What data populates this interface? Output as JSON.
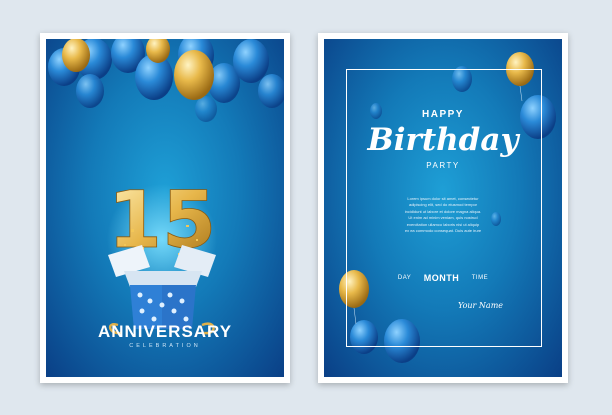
{
  "colors": {
    "page_background": "#dfe7ee",
    "card_border": "#ffffff",
    "card_blue_light": "#1e9fd6",
    "card_blue_dark": "#0a3f86",
    "balloon_gold": "#e8b94a",
    "balloon_blue": "#2a8ad8",
    "text_white": "#ffffff"
  },
  "left_card": {
    "number": "15",
    "title": "ANNIVERSARY",
    "subtitle": "CELEBRATION"
  },
  "right_card": {
    "happy": "HAPPY",
    "birthday": "Birthday",
    "party": "PARTY",
    "body_lines": [
      "Lorem ipsum dolor sit amet, consectetur",
      "adipiscing elit, sed do eiusmod tempor",
      "incididunt ut labore et dolore magna aliqua.",
      "Ut enim ad minim veniam, quis nostrud",
      "exercitation ullamco laboris nisi ut aliquip",
      "ex ea commodo consequat. Duis aute irure"
    ],
    "day": "DAY",
    "month": "MONTH",
    "time": "TIME",
    "your_name": "Your Name"
  }
}
